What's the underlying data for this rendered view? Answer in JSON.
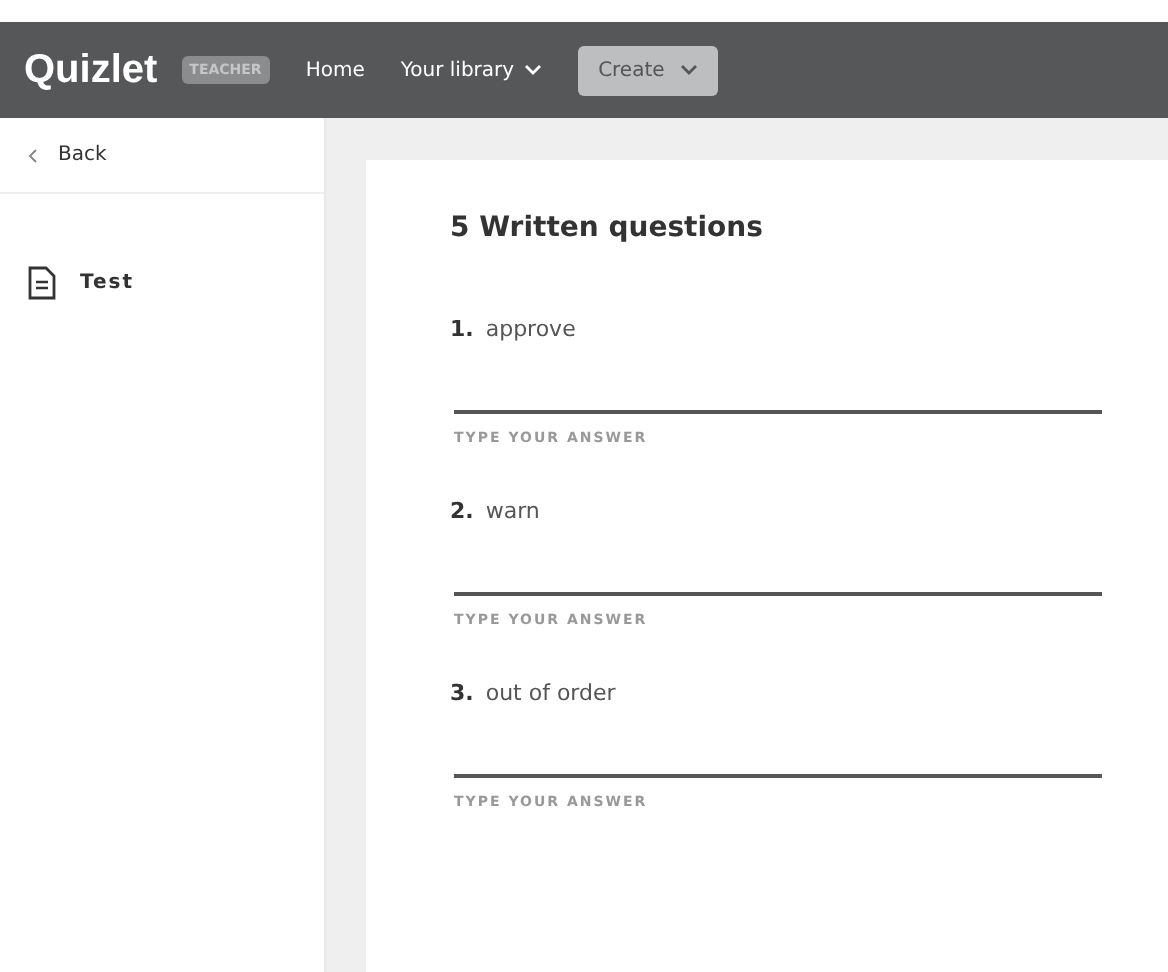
{
  "nav": {
    "logo": "Quizlet",
    "badge": "TEACHER",
    "items": [
      {
        "label": "Home",
        "kind": "link"
      },
      {
        "label": "Your library",
        "kind": "dropdown"
      },
      {
        "label": "Create",
        "kind": "button"
      }
    ]
  },
  "sidebar": {
    "back": "Back",
    "items": [
      {
        "label": "Test"
      }
    ]
  },
  "test": {
    "title": "5 Written questions",
    "questions": [
      {
        "number": "1.",
        "prompt": "approve",
        "answer_label": "TYPE YOUR ANSWER"
      },
      {
        "number": "2.",
        "prompt": "warn",
        "answer_label": "TYPE YOUR ANSWER"
      },
      {
        "number": "3.",
        "prompt": "out of order",
        "answer_label": "TYPE YOUR ANSWER"
      }
    ]
  }
}
